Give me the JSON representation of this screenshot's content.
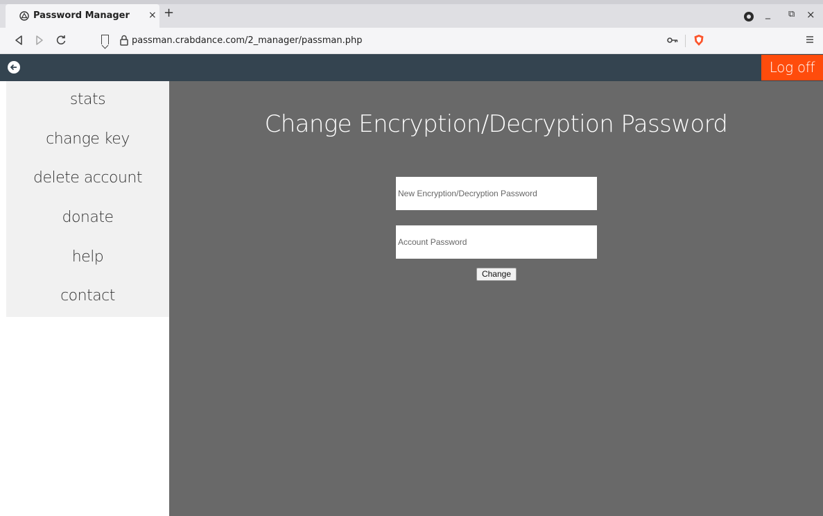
{
  "browser": {
    "tab_title": "Password Manager",
    "tab_close": "×",
    "new_tab": "+",
    "url": "passman.crabdance.com/2_manager/passman.php",
    "window_controls": {
      "minimize": "_",
      "maximize": "⧉",
      "close": "×"
    },
    "icons": [
      "app-tab-icon",
      "back-icon",
      "forward-icon",
      "reload-icon",
      "bookmark-icon",
      "lock-icon",
      "key-icon",
      "brave-shield-icon",
      "menu-icon"
    ]
  },
  "header": {
    "logoff_label": "Log off"
  },
  "sidebar": {
    "items": [
      {
        "label": "stats"
      },
      {
        "label": "change key"
      },
      {
        "label": "delete account"
      },
      {
        "label": "donate"
      },
      {
        "label": "help"
      },
      {
        "label": "contact"
      }
    ]
  },
  "main": {
    "title": "Change Encryption/Decryption Password",
    "new_password_placeholder": "New Encryption/Decryption Password",
    "account_password_placeholder": "Account Password",
    "change_button": "Change"
  },
  "colors": {
    "topbar": "#344450",
    "logoff": "#ff4c0c",
    "main_bg": "#696969",
    "sidebar_bg": "#f1f1f1"
  }
}
